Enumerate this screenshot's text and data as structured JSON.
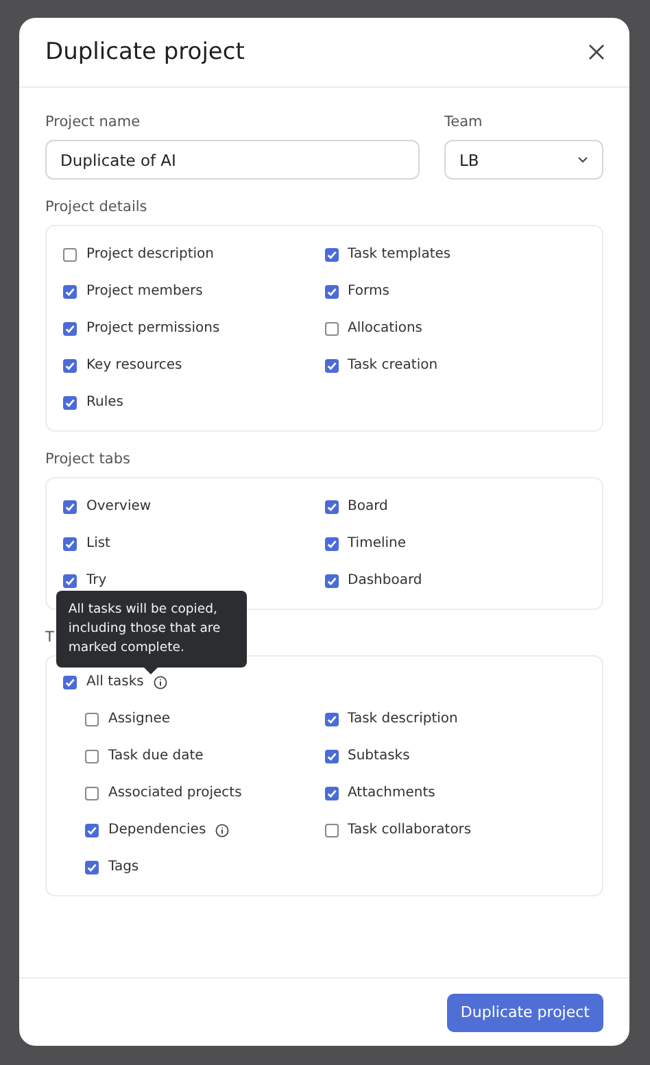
{
  "dialog": {
    "title": "Duplicate project"
  },
  "project_name": {
    "label": "Project name",
    "value": "Duplicate of AI"
  },
  "team": {
    "label": "Team",
    "value": "LB"
  },
  "sections": [
    {
      "title": "Project details",
      "items": [
        {
          "label": "Project description",
          "checked": false
        },
        {
          "label": "Task templates",
          "checked": true
        },
        {
          "label": "Project members",
          "checked": true
        },
        {
          "label": "Forms",
          "checked": true
        },
        {
          "label": "Project permissions",
          "checked": true
        },
        {
          "label": "Allocations",
          "checked": false
        },
        {
          "label": "Key resources",
          "checked": true
        },
        {
          "label": "Task creation",
          "checked": true
        },
        {
          "label": "Rules",
          "checked": true
        }
      ]
    },
    {
      "title": "Project tabs",
      "items": [
        {
          "label": "Overview",
          "checked": true
        },
        {
          "label": "Board",
          "checked": true
        },
        {
          "label": "List",
          "checked": true
        },
        {
          "label": "Timeline",
          "checked": true
        },
        {
          "label": "Try",
          "checked": true
        },
        {
          "label": "Dashboard",
          "checked": true
        }
      ]
    }
  ],
  "tasks": {
    "title": "T",
    "all": {
      "label": "All tasks",
      "checked": true,
      "info": true
    },
    "tooltip": "All tasks will be copied, including those that are marked complete.",
    "items": [
      {
        "label": "Assignee",
        "checked": false,
        "info": false
      },
      {
        "label": "Task description",
        "checked": true,
        "info": false
      },
      {
        "label": "Task due date",
        "checked": false,
        "info": false
      },
      {
        "label": "Subtasks",
        "checked": true,
        "info": false
      },
      {
        "label": "Associated projects",
        "checked": false,
        "info": false
      },
      {
        "label": "Attachments",
        "checked": true,
        "info": false
      },
      {
        "label": "Dependencies",
        "checked": true,
        "info": true
      },
      {
        "label": "Task collaborators",
        "checked": false,
        "info": false
      },
      {
        "label": "Tags",
        "checked": true,
        "info": false
      }
    ]
  },
  "footer": {
    "button": "Duplicate project"
  }
}
